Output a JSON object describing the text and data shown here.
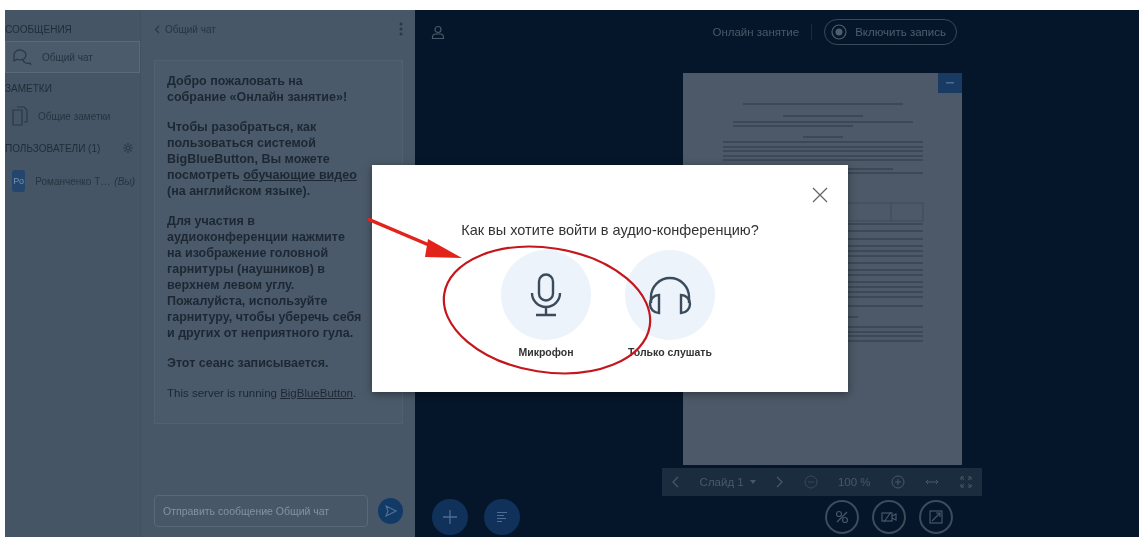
{
  "sidebar": {
    "sections": [
      {
        "kind": "messages",
        "title": "СООБЩЕНИЯ",
        "items": [
          {
            "kind": "chat",
            "label": "Общий чат",
            "selected": true
          }
        ]
      },
      {
        "kind": "notes",
        "title": "ЗАМЕТКИ",
        "items": [
          {
            "kind": "notes",
            "label": "Общие заметки",
            "selected": false
          }
        ]
      },
      {
        "kind": "users",
        "title": "ПОЛЬЗОВАТЕЛИ (1)",
        "items": [
          {
            "kind": "user",
            "avatar": "Ро",
            "label": "Романченко Т…",
            "suffix": "(Вы)",
            "selected": false
          }
        ]
      }
    ]
  },
  "chat": {
    "title": "Общий чат",
    "messages": [
      {
        "kind": "bold",
        "segments": [
          {
            "kind": "text",
            "text": "Добро пожаловать на собрание «**Онлайн занятие**»!"
          }
        ]
      },
      {
        "kind": "bold",
        "segments": [
          {
            "kind": "text",
            "text": "Чтобы разобраться, как пользоваться системой BigBlueButton, Вы можете посмотреть "
          },
          {
            "kind": "link",
            "text": "обучающие видео"
          },
          {
            "kind": "text",
            "text": " (на английском языке)."
          }
        ]
      },
      {
        "kind": "bold",
        "segments": [
          {
            "kind": "text",
            "text": "Для участия в аудиоконференции нажмите на изображение головной гарнитуры (наушников) в верхнем левом углу. **Пожалуйста, используйте гарнитуру, чтобы уберечь себя и других от неприятного гула.**"
          }
        ]
      },
      {
        "kind": "bold",
        "segments": [
          {
            "kind": "text",
            "text": "Этот сеанс записывается."
          }
        ]
      },
      {
        "kind": "plain",
        "segments": [
          {
            "kind": "text",
            "text": "This server is running "
          },
          {
            "kind": "link",
            "text": "BigBlueButton"
          },
          {
            "kind": "text",
            "text": "."
          }
        ]
      }
    ],
    "input": {
      "placeholder": "Отправить сообщение Общий чат"
    }
  },
  "topbar": {
    "meeting_title": "Онлайн занятие",
    "record_button": "Включить запись"
  },
  "presentation": {
    "slide_label": "Слайд 1",
    "zoom": "100 %"
  },
  "dialog": {
    "title": "Как вы хотите войти в аудио-конференцию?",
    "options": [
      {
        "kind": "microphone",
        "label": "Микрофон"
      },
      {
        "kind": "listen",
        "label": "Только слушать"
      }
    ]
  }
}
